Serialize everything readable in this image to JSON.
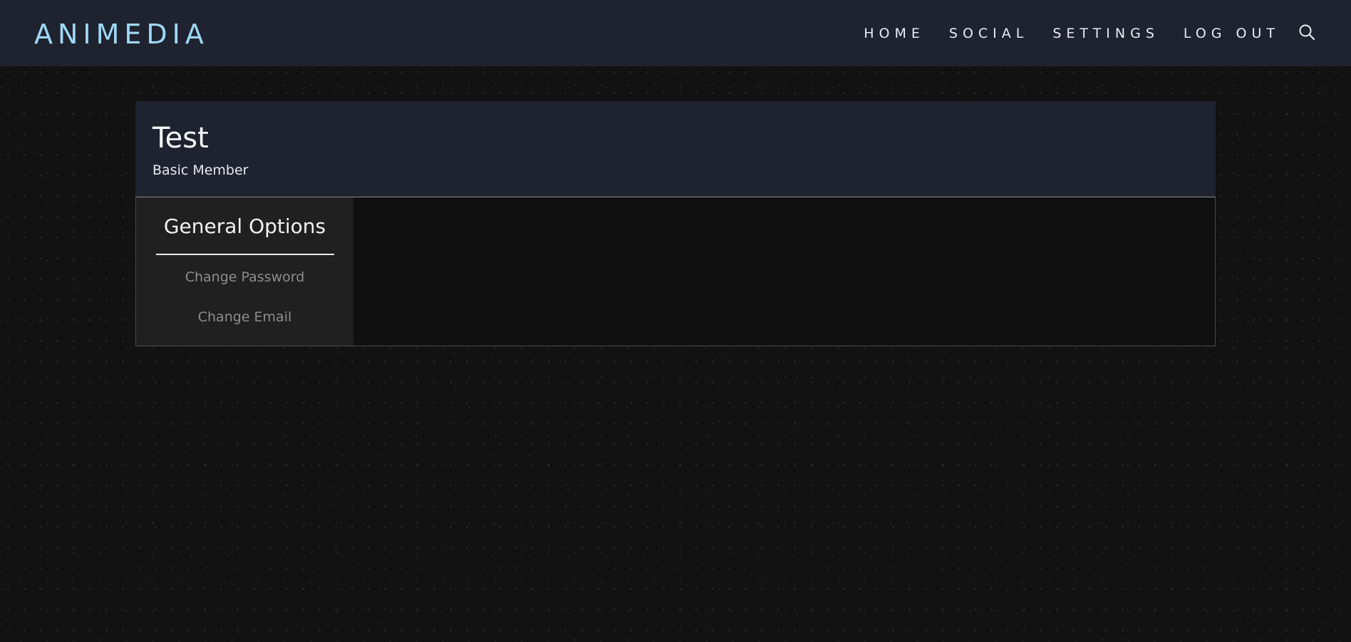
{
  "brand": {
    "name": "ANIMEDIA",
    "color": "#9fd8f5"
  },
  "nav": {
    "links": [
      {
        "label": "HOME"
      },
      {
        "label": "SOCIAL"
      },
      {
        "label": "SETTINGS"
      },
      {
        "label": "LOG OUT"
      }
    ],
    "search_icon": "search-icon"
  },
  "profile": {
    "name": "Test",
    "role": "Basic Member"
  },
  "options": {
    "title": "General Options",
    "items": [
      {
        "label": "Change Password"
      },
      {
        "label": "Change Email"
      }
    ]
  },
  "colors": {
    "header_bg": "#1f2330",
    "page_bg": "#121212",
    "sidebar_bg": "#202020",
    "option_text": "#8d8d8d"
  }
}
